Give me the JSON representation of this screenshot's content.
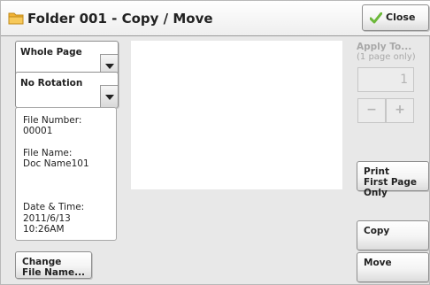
{
  "header": {
    "title": "Folder 001 - Copy / Move",
    "title_icon": "folder-icon",
    "close_label": "Close",
    "close_icon": "check-icon"
  },
  "dropdowns": {
    "page_scope": {
      "value": "Whole Page"
    },
    "rotation": {
      "value": "No Rotation"
    }
  },
  "file_info": {
    "number_label": "File Number:",
    "number_value": "00001",
    "name_label": "File Name:",
    "name_value": "Doc Name101",
    "datetime_label": "Date & Time:",
    "date_value": "2011/6/13",
    "time_value": "10:26AM"
  },
  "apply": {
    "label": "Apply To...",
    "sublabel": "(1 page only)",
    "pages_value": "1",
    "minus_label": "−",
    "plus_label": "+"
  },
  "buttons": {
    "print_first": "Print\nFirst Page Only",
    "copy": "Copy",
    "move": "Move",
    "change_file_name": "Change\nFile Name..."
  },
  "colors": {
    "folder_icon": "#f2b233",
    "check_icon": "#6cb83a",
    "disabled_text": "#a8a8a8"
  }
}
